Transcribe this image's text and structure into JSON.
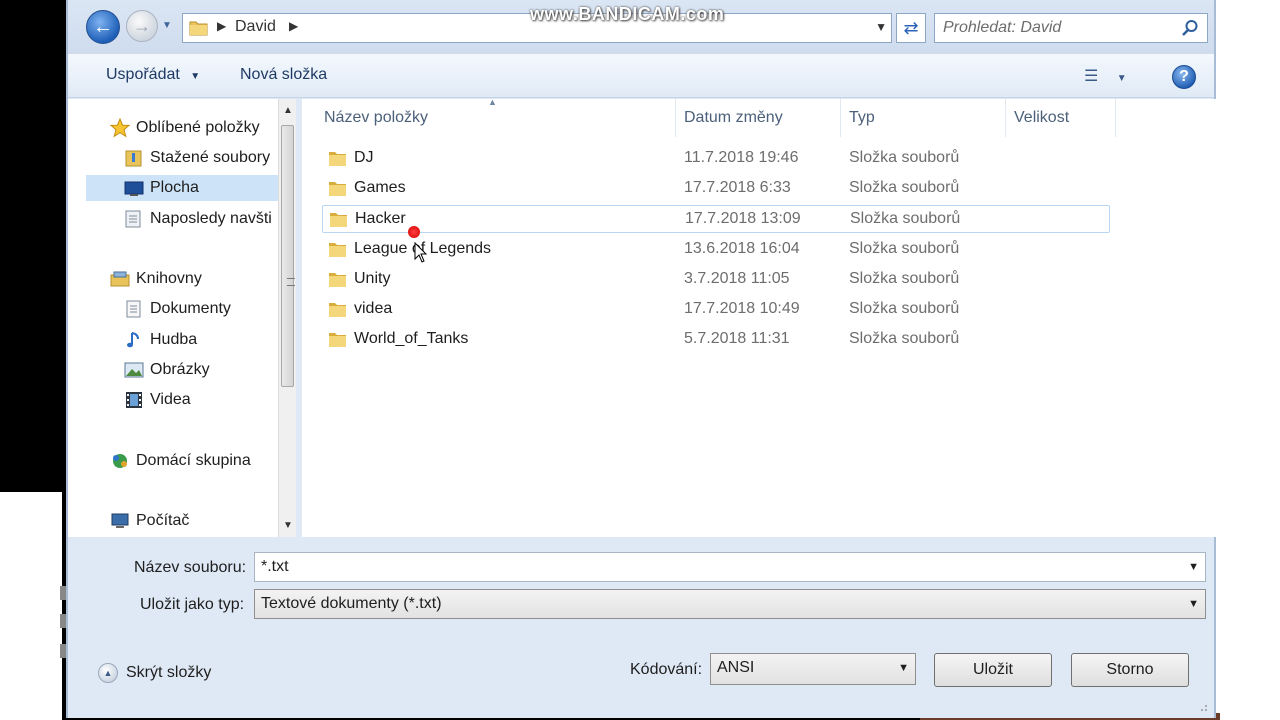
{
  "watermark": "www.BANDICAM.com",
  "address": {
    "crumb": "David",
    "search_placeholder": "Prohledat: David"
  },
  "toolbar": {
    "organize_label": "Uspořádat",
    "new_folder_label": "Nová složka"
  },
  "nav": {
    "favorites": "Oblíbené položky",
    "downloads": "Stažené soubory",
    "desktop": "Plocha",
    "recent": "Naposledy navšti",
    "libraries": "Knihovny",
    "documents": "Dokumenty",
    "music": "Hudba",
    "pictures": "Obrázky",
    "videos": "Videa",
    "homegroup": "Domácí skupina",
    "computer": "Počítač"
  },
  "columns": {
    "name": "Název položky",
    "date": "Datum změny",
    "type": "Typ",
    "size": "Velikost"
  },
  "files": [
    {
      "name": "DJ",
      "date": "11.7.2018 19:46",
      "type": "Složka souborů"
    },
    {
      "name": "Games",
      "date": "17.7.2018 6:33",
      "type": "Složka souborů"
    },
    {
      "name": "Hacker",
      "date": "17.7.2018 13:09",
      "type": "Složka souborů"
    },
    {
      "name": "League of Legends",
      "date": "13.6.2018 16:04",
      "type": "Složka souborů"
    },
    {
      "name": "Unity",
      "date": "3.7.2018 11:05",
      "type": "Složka souborů"
    },
    {
      "name": "videa",
      "date": "17.7.2018 10:49",
      "type": "Složka souborů"
    },
    {
      "name": "World_of_Tanks",
      "date": "5.7.2018 11:31",
      "type": "Složka souborů"
    }
  ],
  "form": {
    "filename_label": "Název souboru:",
    "filename_value": "*.txt",
    "savetype_label": "Uložit jako typ:",
    "savetype_value": "Textové dokumenty (*.txt)",
    "encoding_label": "Kódování:",
    "encoding_value": "ANSI"
  },
  "buttons": {
    "hide_folders": "Skrýt složky",
    "save": "Uložit",
    "cancel": "Storno"
  }
}
